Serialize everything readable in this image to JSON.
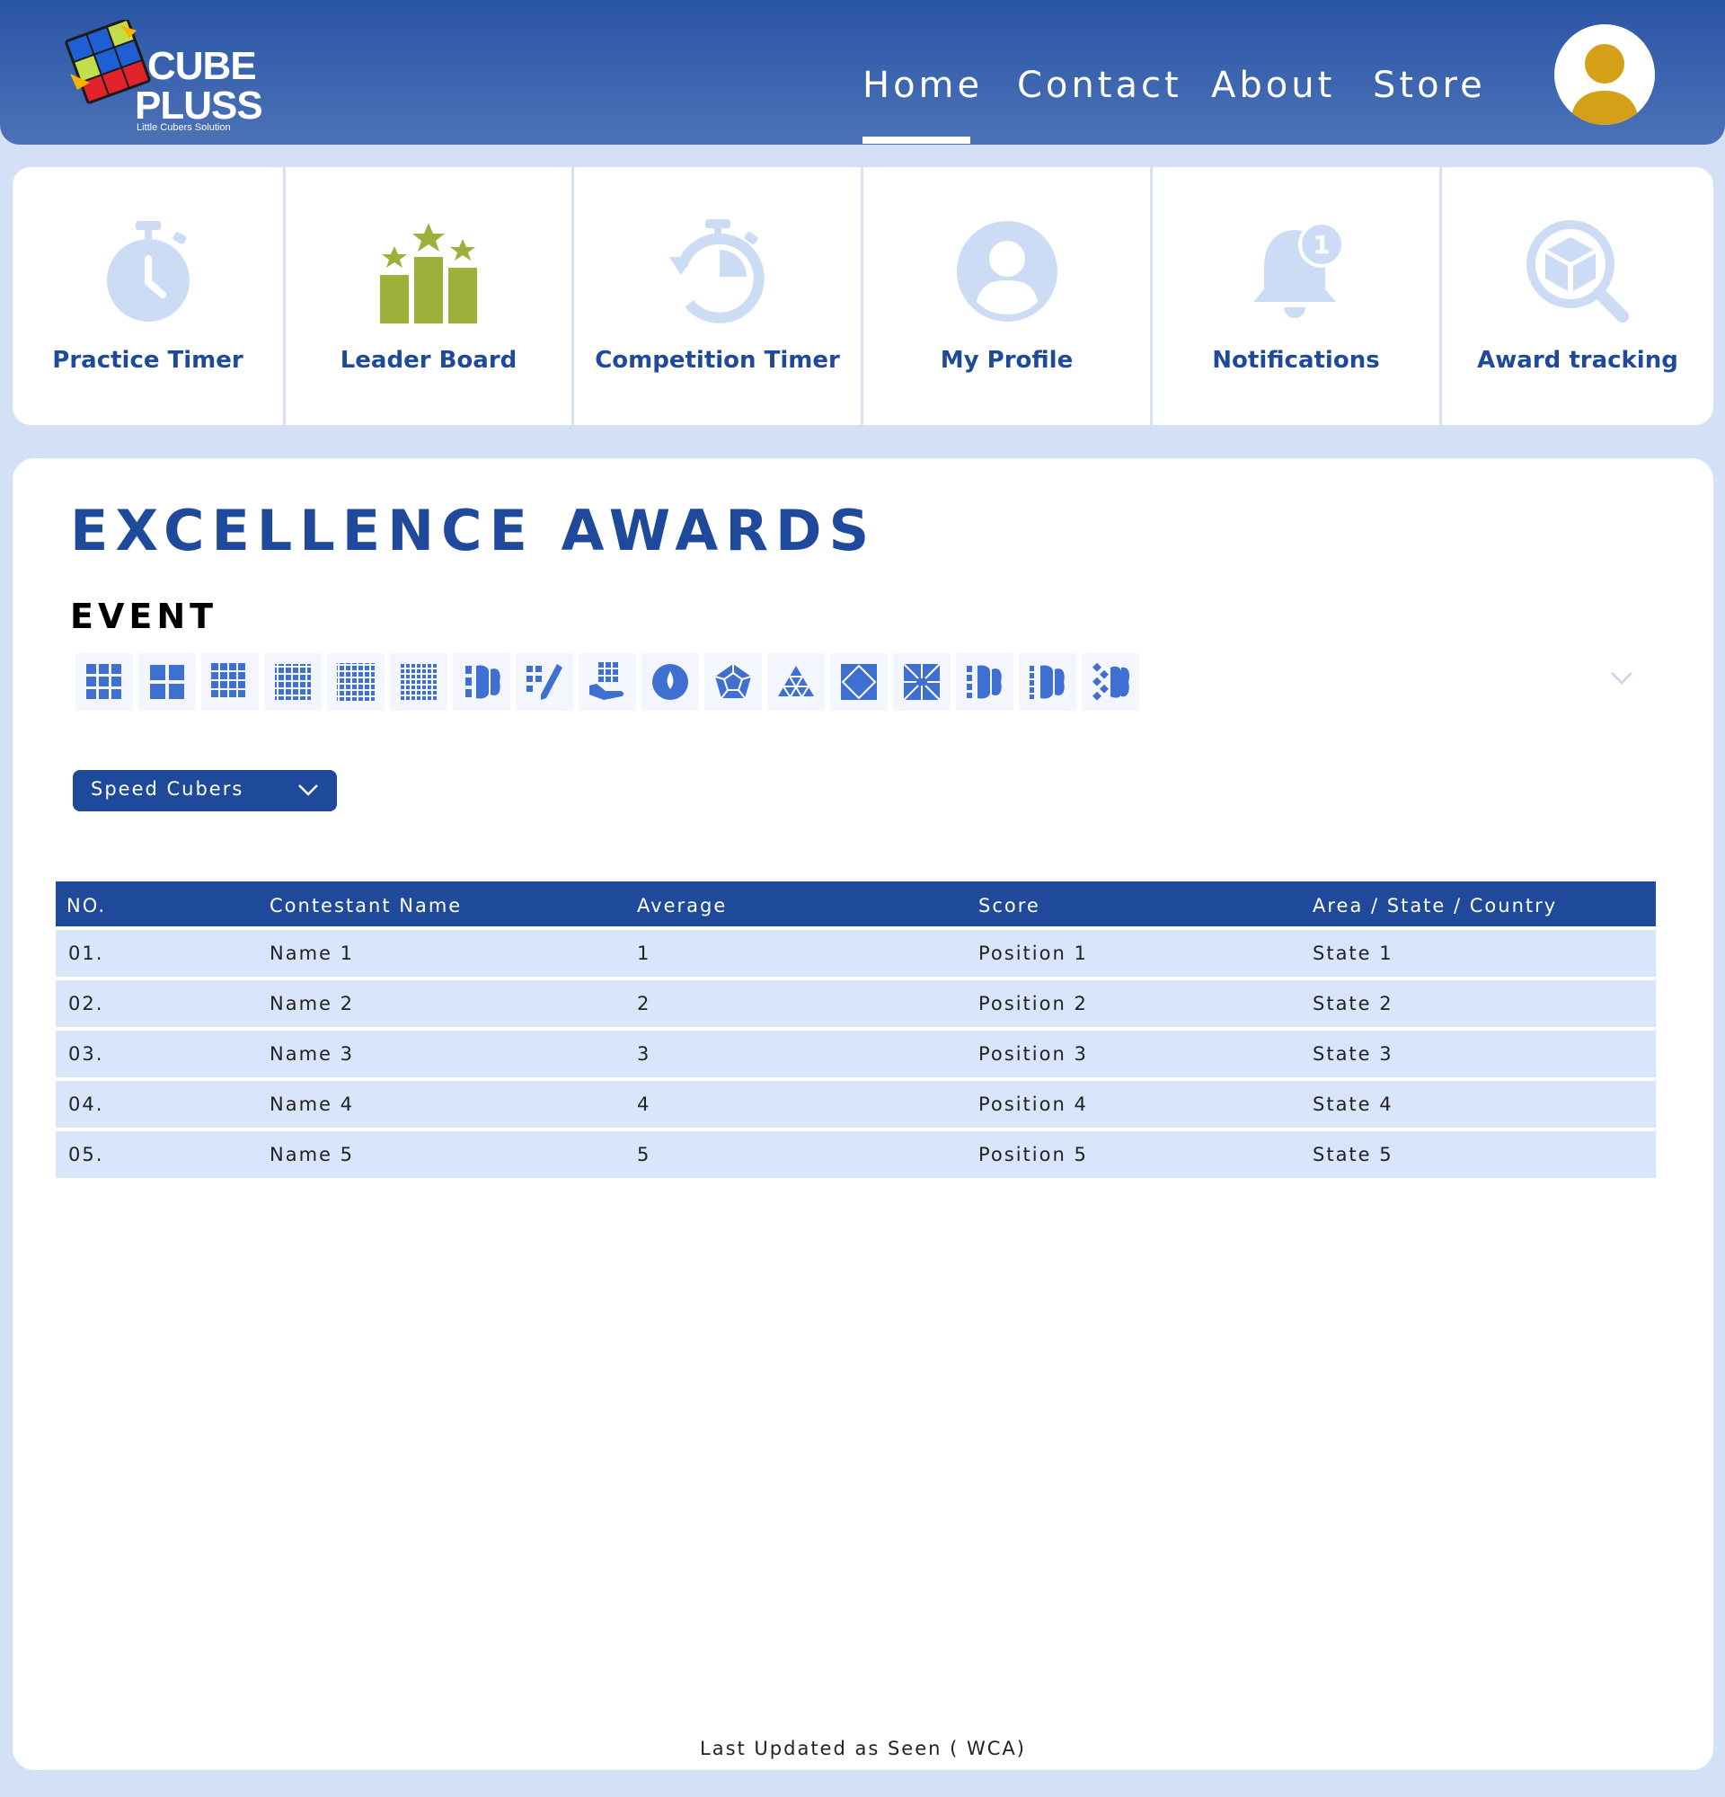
{
  "brand": {
    "name_line1": "CUBE",
    "name_line2": "PLUSS",
    "tagline": "Little Cubers Solution"
  },
  "nav": {
    "items": [
      {
        "label": "Home",
        "active": true
      },
      {
        "label": "Contact",
        "active": false
      },
      {
        "label": "About",
        "active": false
      },
      {
        "label": "Store",
        "active": false
      }
    ]
  },
  "quick_nav": {
    "items": [
      {
        "label": "Practice Timer",
        "icon": "stopwatch-icon"
      },
      {
        "label": "Leader Board",
        "icon": "podium-stars-icon"
      },
      {
        "label": "Competition Timer",
        "icon": "timer-reset-icon"
      },
      {
        "label": "My Profile",
        "icon": "user-circle-icon"
      },
      {
        "label": "Notifications",
        "icon": "bell-badge-icon"
      },
      {
        "label": "Award tracking",
        "icon": "cube-search-icon"
      }
    ],
    "notification_badge": "1"
  },
  "main": {
    "title": "EXCELLENCE AWARDS",
    "event_label": "EVENT",
    "events": [
      "3x3x3-cube-icon",
      "2x2x2-cube-icon",
      "4x4x4-cube-icon",
      "5x5x5-cube-icon",
      "6x6x6-cube-icon",
      "7x7x7-cube-icon",
      "3x3-blindfolded-icon",
      "3x3-fewest-moves-icon",
      "3x3-one-handed-icon",
      "clock-icon",
      "megaminx-icon",
      "pyraminx-icon",
      "skewb-icon",
      "square-1-icon",
      "4x4-blindfolded-icon",
      "5x5-blindfolded-icon",
      "3x3-multi-blind-icon"
    ],
    "category": "Speed Cubers",
    "table": {
      "headers": [
        "NO.",
        "Contestant Name",
        "Average",
        "Score",
        "Area / State / Country"
      ],
      "rows": [
        [
          "01.",
          "Name 1",
          "1",
          "Position 1",
          "State 1"
        ],
        [
          "02.",
          "Name 2",
          "2",
          "Position 2",
          "State 2"
        ],
        [
          "03.",
          "Name 3",
          "3",
          "Position 3",
          "State 3"
        ],
        [
          "04.",
          "Name 4",
          "4",
          "Position 4",
          "State 4"
        ],
        [
          "05.",
          "Name 5",
          "5",
          "Position 5",
          "State 5"
        ]
      ]
    },
    "footnote": "Last Updated as Seen ( WCA)"
  },
  "colors": {
    "primary": "#1f4a9c",
    "header_gradient_top": "#2a55a5",
    "header_gradient_bottom": "#4c72b8",
    "icon_light": "#cddcf5",
    "icon_accent": "#9bb13a",
    "event_icon": "#3f6fd0",
    "row_bg": "#d8e5fb",
    "page_bg": "#d3e0f6",
    "avatar_accent": "#d4a017"
  }
}
